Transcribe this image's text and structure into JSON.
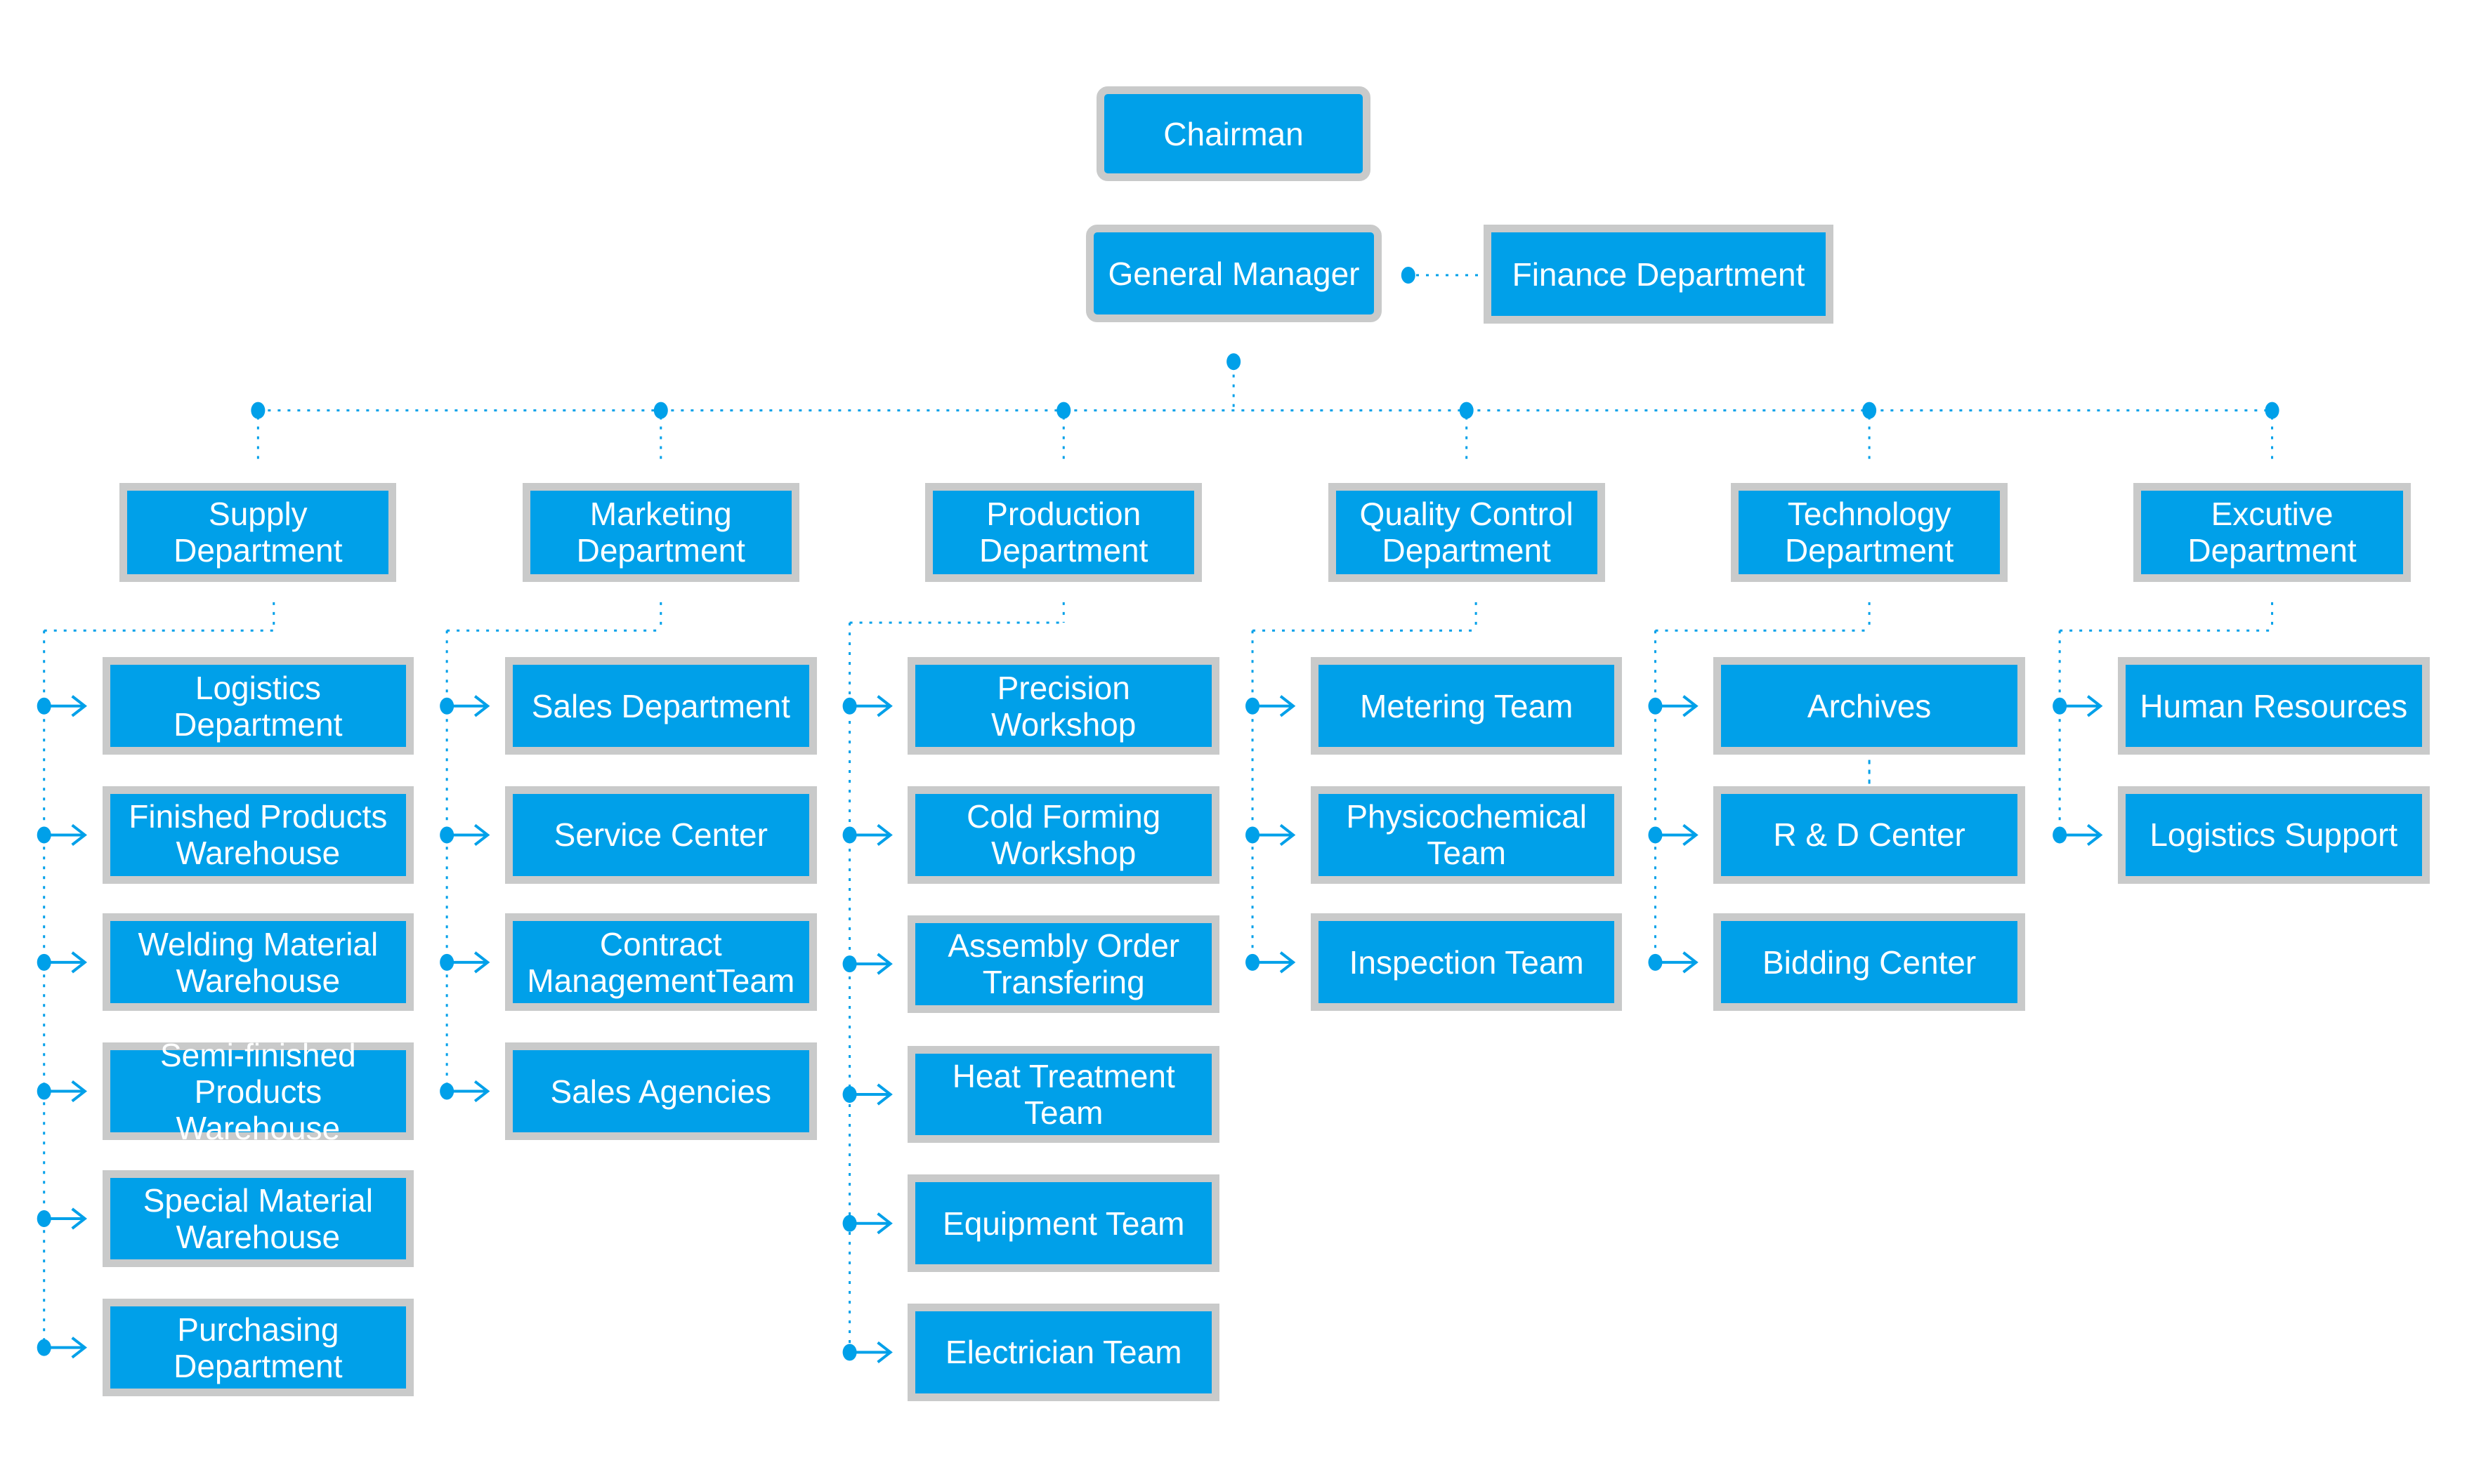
{
  "colors": {
    "box_fill": "#00A0E9",
    "box_border": "#C9CACA",
    "connector": "#00A0E9",
    "text": "#FFFFFF"
  },
  "top": {
    "chairman": "Chairman",
    "general_manager": "General Manager",
    "finance": "Finance Department"
  },
  "departments": [
    {
      "label": "Supply\nDepartment",
      "children": [
        "Logistics\nDepartment",
        "Finished Products\nWarehouse",
        "Welding Material\nWarehouse",
        "Semi-finished\nProducts Warehouse",
        "Special Material\nWarehouse",
        "Purchasing\nDepartment"
      ]
    },
    {
      "label": "Marketing\nDepartment",
      "children": [
        "Sales Department",
        "Service Center",
        "Contract\nManagementTeam",
        "Sales Agencies"
      ]
    },
    {
      "label": "Production\nDepartment",
      "children": [
        "Precision\nWorkshop",
        "Cold Forming\nWorkshop",
        "Assembly Order\nTransfering",
        "Heat Treatment\nTeam",
        "Equipment Team",
        "Electrician Team"
      ]
    },
    {
      "label": "Quality Control\nDepartment",
      "children": [
        "Metering Team",
        "Physicochemical\nTeam",
        "Inspection Team"
      ]
    },
    {
      "label": "Technology\nDepartment",
      "children": [
        "Archives",
        "R & D Center",
        "Bidding Center"
      ]
    },
    {
      "label": "Excutive\nDepartment",
      "children": [
        "Human Resources",
        "Logistics Support"
      ]
    }
  ]
}
